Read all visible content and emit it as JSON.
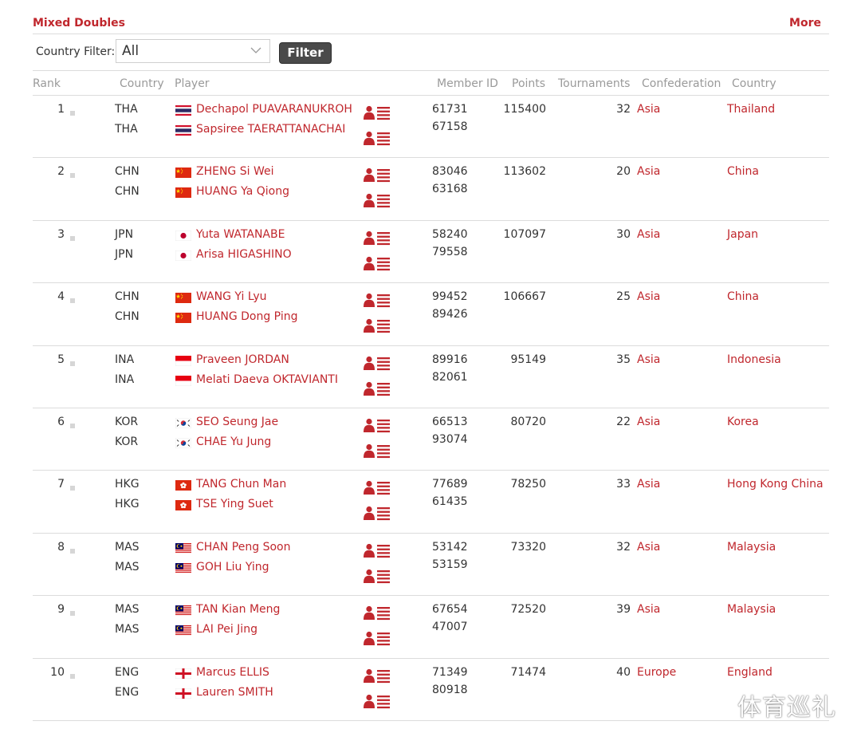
{
  "header": {
    "title": "Mixed Doubles",
    "more": "More"
  },
  "filter": {
    "label": "Country Filter:",
    "selected": "All",
    "button": "Filter"
  },
  "columns": {
    "rank": "Rank",
    "country": "Country",
    "player": "Player",
    "member_id": "Member ID",
    "points": "Points",
    "tournaments": "Tournaments",
    "confederation": "Confederation",
    "country_name": "Country"
  },
  "rows": [
    {
      "rank": "1",
      "points": "115400",
      "tournaments": "32",
      "confederation": "Asia",
      "country": "Thailand",
      "players": [
        {
          "code": "THA",
          "name": "Dechapol PUAVARANUKROH",
          "member_id": "61731",
          "flag": "thailand-flag"
        },
        {
          "code": "THA",
          "name": "Sapsiree TAERATTANACHAI",
          "member_id": "67158",
          "flag": "thailand-flag"
        }
      ]
    },
    {
      "rank": "2",
      "points": "113602",
      "tournaments": "20",
      "confederation": "Asia",
      "country": "China",
      "players": [
        {
          "code": "CHN",
          "name": "ZHENG Si Wei",
          "member_id": "83046",
          "flag": "china-flag"
        },
        {
          "code": "CHN",
          "name": "HUANG Ya Qiong",
          "member_id": "63168",
          "flag": "china-flag"
        }
      ]
    },
    {
      "rank": "3",
      "points": "107097",
      "tournaments": "30",
      "confederation": "Asia",
      "country": "Japan",
      "players": [
        {
          "code": "JPN",
          "name": "Yuta WATANABE",
          "member_id": "58240",
          "flag": "japan-flag"
        },
        {
          "code": "JPN",
          "name": "Arisa HIGASHINO",
          "member_id": "79558",
          "flag": "japan-flag"
        }
      ]
    },
    {
      "rank": "4",
      "points": "106667",
      "tournaments": "25",
      "confederation": "Asia",
      "country": "China",
      "players": [
        {
          "code": "CHN",
          "name": "WANG Yi Lyu",
          "member_id": "99452",
          "flag": "china-flag"
        },
        {
          "code": "CHN",
          "name": "HUANG Dong Ping",
          "member_id": "89426",
          "flag": "china-flag"
        }
      ]
    },
    {
      "rank": "5",
      "points": "95149",
      "tournaments": "35",
      "confederation": "Asia",
      "country": "Indonesia",
      "players": [
        {
          "code": "INA",
          "name": "Praveen JORDAN",
          "member_id": "89916",
          "flag": "indonesia-flag"
        },
        {
          "code": "INA",
          "name": "Melati Daeva OKTAVIANTI",
          "member_id": "82061",
          "flag": "indonesia-flag"
        }
      ]
    },
    {
      "rank": "6",
      "points": "80720",
      "tournaments": "22",
      "confederation": "Asia",
      "country": "Korea",
      "players": [
        {
          "code": "KOR",
          "name": "SEO Seung Jae",
          "member_id": "66513",
          "flag": "korea-flag"
        },
        {
          "code": "KOR",
          "name": "CHAE Yu Jung",
          "member_id": "93074",
          "flag": "korea-flag"
        }
      ]
    },
    {
      "rank": "7",
      "points": "78250",
      "tournaments": "33",
      "confederation": "Asia",
      "country": "Hong Kong China",
      "players": [
        {
          "code": "HKG",
          "name": "TANG Chun Man",
          "member_id": "77689",
          "flag": "hongkong-flag"
        },
        {
          "code": "HKG",
          "name": "TSE Ying Suet",
          "member_id": "61435",
          "flag": "hongkong-flag"
        }
      ]
    },
    {
      "rank": "8",
      "points": "73320",
      "tournaments": "32",
      "confederation": "Asia",
      "country": "Malaysia",
      "players": [
        {
          "code": "MAS",
          "name": "CHAN Peng Soon",
          "member_id": "53142",
          "flag": "malaysia-flag"
        },
        {
          "code": "MAS",
          "name": "GOH Liu Ying",
          "member_id": "53159",
          "flag": "malaysia-flag"
        }
      ]
    },
    {
      "rank": "9",
      "points": "72520",
      "tournaments": "39",
      "confederation": "Asia",
      "country": "Malaysia",
      "players": [
        {
          "code": "MAS",
          "name": "TAN Kian Meng",
          "member_id": "67654",
          "flag": "malaysia-flag"
        },
        {
          "code": "MAS",
          "name": "LAI Pei Jing",
          "member_id": "47007",
          "flag": "malaysia-flag"
        }
      ]
    },
    {
      "rank": "10",
      "points": "71474",
      "tournaments": "40",
      "confederation": "Europe",
      "country": "England",
      "players": [
        {
          "code": "ENG",
          "name": "Marcus ELLIS",
          "member_id": "71349",
          "flag": "england-flag"
        },
        {
          "code": "ENG",
          "name": "Lauren SMITH",
          "member_id": "80918",
          "flag": "england-flag"
        }
      ]
    }
  ],
  "icons": {
    "profile": "player-profile-icon",
    "rank_marker": "rank-change-marker"
  },
  "colors": {
    "accent": "#c0272d",
    "muted": "#9a9a9a",
    "divider": "#dcdcdc",
    "button": "#4a4a4a"
  },
  "watermark": "体育巡礼"
}
